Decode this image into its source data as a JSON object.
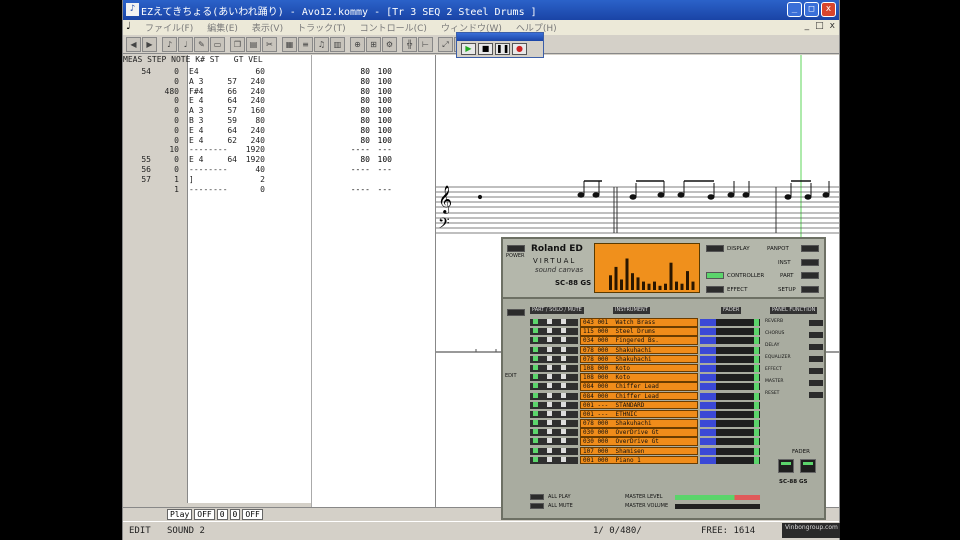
{
  "title": "EZえてきちょる(あいわれ踊り) - Avo12.kommy - [Tr 3  SEQ  2 Steel Drums        ]",
  "menu": [
    "ファイル(F)",
    "編集(E)",
    "表示(V)",
    "トラック(T)",
    "コントロール(C)",
    "ウィンドウ(W)",
    "ヘルプ(H)"
  ],
  "mdi_controls": [
    "_",
    "□",
    "x"
  ],
  "event_list": {
    "header": "MEAS STEP NOTE K# ST   GT VEL",
    "rows": [
      {
        "meas": "54",
        "step": "0",
        "note": "E4",
        "k": "",
        "st": "60",
        "gt": "80",
        "vel": "100"
      },
      {
        "meas": "",
        "step": "0",
        "note": "A 3",
        "k": "57",
        "st": "240",
        "gt": "80",
        "vel": "100"
      },
      {
        "meas": "",
        "step": "480",
        "note": "F#4",
        "k": "66",
        "st": "240",
        "gt": "80",
        "vel": "100"
      },
      {
        "meas": "",
        "step": "0",
        "note": "E 4",
        "k": "64",
        "st": "240",
        "gt": "80",
        "vel": "100"
      },
      {
        "meas": "",
        "step": "0",
        "note": "A 3",
        "k": "57",
        "st": "160",
        "gt": "80",
        "vel": "100"
      },
      {
        "meas": "",
        "step": "0",
        "note": "B 3",
        "k": "59",
        "st": "80",
        "gt": "80",
        "vel": "100"
      },
      {
        "meas": "",
        "step": "0",
        "note": "E 4",
        "k": "64",
        "st": "240",
        "gt": "80",
        "vel": "100"
      },
      {
        "meas": "",
        "step": "0",
        "note": "E 4",
        "k": "62",
        "st": "240",
        "gt": "80",
        "vel": "100"
      },
      {
        "meas": "",
        "step": "10",
        "note": "--------",
        "k": "",
        "st": "1920",
        "gt": "----",
        "vel": "---"
      },
      {
        "meas": "55",
        "step": "0",
        "note": "E 4",
        "k": "64",
        "st": "1920",
        "gt": "80",
        "vel": "100"
      },
      {
        "meas": "56",
        "step": "0",
        "note": "--------",
        "k": "",
        "st": "40",
        "gt": "----",
        "vel": "---"
      },
      {
        "meas": "57",
        "step": "1",
        "note": "]",
        "k": "",
        "st": "2",
        "gt": "",
        "vel": ""
      },
      {
        "meas": "",
        "step": "1",
        "note": "--------",
        "k": "",
        "st": "0",
        "gt": "----",
        "vel": "---"
      }
    ]
  },
  "bottombar": {
    "fields": [
      "Play",
      "OFF",
      "0",
      "0",
      "OFF"
    ]
  },
  "statusbar": {
    "mode": "EDIT",
    "sound": "SOUND 2",
    "position": "1/ 0/480/",
    "free": "FREE: 1614"
  },
  "roland": {
    "brand": "Roland ED",
    "line2": "VIRTUAL",
    "line3": "sound canvas",
    "logo": "SC-88 GS",
    "labels_right": [
      "DISPLAY",
      "PANPOT",
      "INST",
      "CONTROLLER",
      "PART",
      "EFFECT",
      "SETUP"
    ],
    "power": "POWER",
    "col_headers": [
      "PART / SOLO / MUTE",
      "INSTRUMENT",
      "FADER",
      "PANEL FUNCTION"
    ],
    "side_labels": [
      "REVERB",
      "CHORUS",
      "DELAY",
      "EQUALIZER",
      "EFFECT",
      "MASTER",
      "RESET"
    ],
    "parts": [
      {
        "n": "1",
        "inst": "043 001  Watch Brass"
      },
      {
        "n": "2",
        "inst": "115 000  Steel Drums"
      },
      {
        "n": "3",
        "inst": "034 000  Fingered Bs."
      },
      {
        "n": "4",
        "inst": "078 000  Shakuhachi"
      },
      {
        "n": "5",
        "inst": "078 000  Shakuhachi"
      },
      {
        "n": "6",
        "inst": "108 000  Koto"
      },
      {
        "n": "7",
        "inst": "108 000  Koto"
      },
      {
        "n": "8",
        "inst": "084 000  Chiffer Lead"
      },
      {
        "n": "9",
        "inst": "084 000  Chiffer Lead"
      },
      {
        "n": "10",
        "inst": "001 ---  STANDARD"
      },
      {
        "n": "11",
        "inst": "001 ---  ETHNIC"
      },
      {
        "n": "12",
        "inst": "078 000  Shakuhachi"
      },
      {
        "n": "13",
        "inst": "030 000  OverDrive Gt"
      },
      {
        "n": "14",
        "inst": "030 000  OverDrive Gt"
      },
      {
        "n": "15",
        "inst": "107 000  Shamisen"
      },
      {
        "n": "16",
        "inst": "001 000  Piano 1"
      }
    ],
    "bottom_labels": [
      "ALL PLAY",
      "MASTER LEVEL",
      "ALL MUTE",
      "MASTER VOLUME"
    ],
    "fader_label": "FADER",
    "edit": "EDIT"
  },
  "watermark": "Vinbongroup.com",
  "display_bars": [
    0.35,
    0.55,
    0.25,
    0.75,
    0.4,
    0.3,
    0.2,
    0.15,
    0.2,
    0.1,
    0.15,
    0.65,
    0.2,
    0.15,
    0.45,
    0.2
  ]
}
